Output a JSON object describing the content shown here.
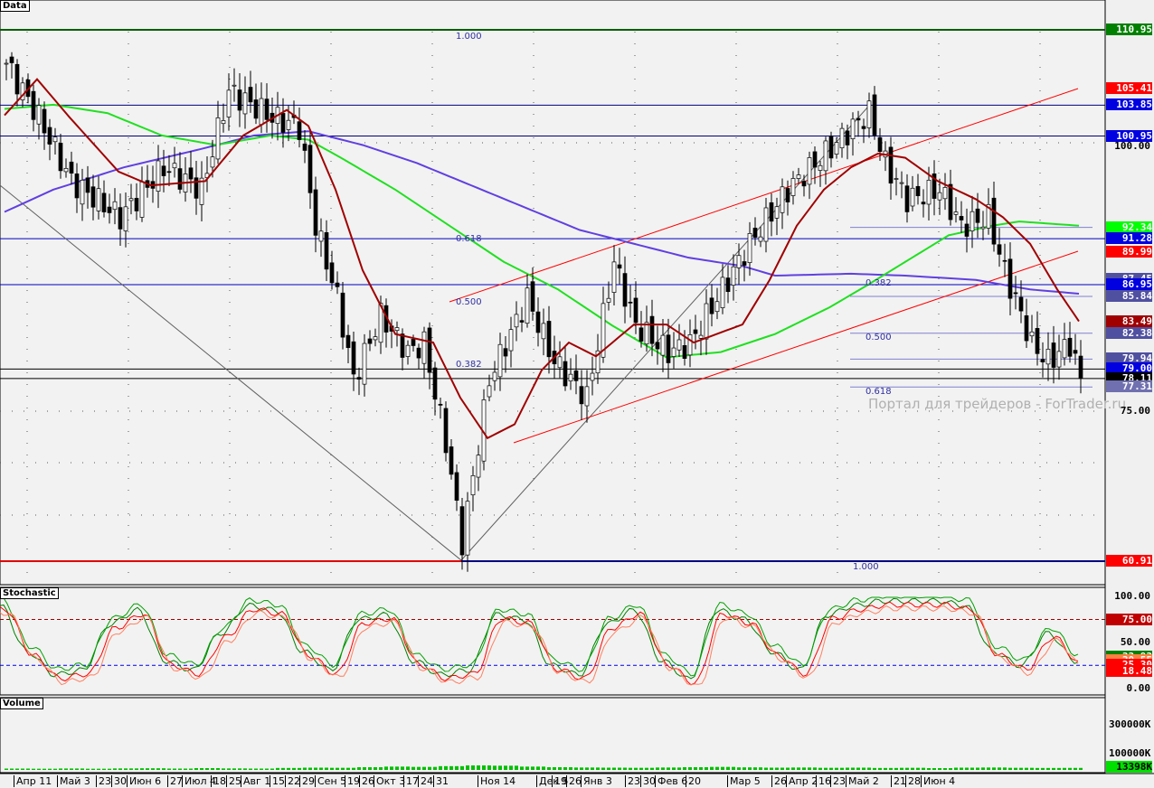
{
  "panes": {
    "main": "Data",
    "stoch": "Stochastic",
    "volume": "Volume"
  },
  "watermark": "Портал для трейдеров - ForTrader.ru",
  "price_tags": [
    {
      "v": "110.95",
      "c": "#008000"
    },
    {
      "v": "105.41",
      "c": "#ff0000"
    },
    {
      "v": "103.85",
      "c": "#0000e0"
    },
    {
      "v": "100.95",
      "c": "#0000e0"
    },
    {
      "v": "92.34",
      "c": "#00ff00"
    },
    {
      "v": "91.28",
      "c": "#0000e0"
    },
    {
      "v": "89.99",
      "c": "#ff0000"
    },
    {
      "v": "87.45",
      "c": "#5050a0"
    },
    {
      "v": "86.95",
      "c": "#0000e0"
    },
    {
      "v": "85.84",
      "c": "#5050a0"
    },
    {
      "v": "83.49",
      "c": "#a00000"
    },
    {
      "v": "82.38",
      "c": "#5050a0"
    },
    {
      "v": "79.94",
      "c": "#5050a0"
    },
    {
      "v": "79.00",
      "c": "#0000e0"
    },
    {
      "v": "78.11",
      "c": "#000000"
    },
    {
      "v": "77.31",
      "c": "#7070b0"
    },
    {
      "v": "60.91",
      "c": "#ff0000"
    }
  ],
  "price_axis": [
    "100.00",
    "75.00"
  ],
  "stoch_axis": [
    "100.00",
    "50.00",
    "0.00"
  ],
  "stoch_tags": [
    {
      "v": "75.00",
      "c": "#c00000"
    },
    {
      "v": "33.93",
      "c": "#008000"
    },
    {
      "v": "30.55",
      "c": "#ff8040"
    },
    {
      "v": "25.30",
      "c": "#ff0000"
    },
    {
      "v": "18.48",
      "c": "#ff0000"
    }
  ],
  "volume_axis": [
    "300000K",
    "100000K"
  ],
  "volume_tag": "13398K",
  "fib_left": [
    "1.000",
    "0.618",
    "0.500",
    "0.382"
  ],
  "fib_right": [
    "0.382",
    "0.500",
    "0.618",
    "1.000"
  ],
  "dates": [
    "Апр 11",
    "Май 3",
    "23",
    "30",
    "Июн 6",
    "27",
    "Июл 4",
    "18",
    "25",
    "Авг 1",
    "15",
    "22",
    "29",
    "Сен 5",
    "19",
    "26",
    "Окт 3",
    "17",
    "24",
    "31",
    "Ноя 14",
    "Дек 5",
    "19",
    "26",
    "Янв 3",
    "23",
    "30",
    "Фев 6",
    "20",
    "Мар 5",
    "26",
    "Апр 2",
    "16",
    "23",
    "Май 2",
    "21",
    "28",
    "Июн 4"
  ],
  "chart_data": {
    "type": "candlestick",
    "ylim": [
      60.91,
      110.95
    ],
    "closes": {
      "t": [
        0,
        6,
        12,
        21,
        29,
        36,
        41,
        49,
        54,
        57,
        61,
        64,
        69,
        74,
        77,
        81,
        84,
        89,
        96,
        101,
        107,
        112,
        116,
        122,
        126,
        131,
        137,
        144,
        151,
        156,
        159,
        162,
        166,
        172,
        176,
        181,
        184,
        189,
        192,
        196,
        198
      ],
      "p": [
        107.8,
        102.7,
        96.7,
        93.3,
        98,
        95.9,
        105.2,
        102.7,
        101.8,
        92.5,
        85.7,
        78,
        84,
        80.6,
        81.4,
        72.1,
        62.7,
        78,
        85.7,
        79.7,
        76.3,
        89.1,
        83.1,
        80.6,
        81.4,
        85.7,
        90.8,
        95.9,
        99.3,
        101.8,
        103.1,
        98.4,
        95,
        95.9,
        92.5,
        93.3,
        88.2,
        81.4,
        79.7,
        81.4,
        78
      ]
    },
    "ma_fast": {
      "t": [
        0,
        6,
        12,
        21,
        27,
        37,
        44,
        52,
        56,
        61,
        66,
        72,
        79,
        84,
        89,
        94,
        99,
        104,
        109,
        116,
        122,
        127,
        136,
        141,
        146,
        151,
        156,
        161,
        166,
        172,
        179,
        184,
        189,
        194,
        198
      ],
      "p": [
        102.9,
        106.3,
        102.7,
        97.6,
        96.3,
        96.7,
        101,
        103.4,
        101.9,
        95.9,
        88.3,
        82.3,
        81.5,
        76.3,
        72.5,
        73.8,
        78.9,
        81.5,
        80.2,
        83.2,
        83.2,
        81.5,
        83.2,
        87.4,
        92.5,
        95.9,
        98,
        99.3,
        98.9,
        96.7,
        95,
        93.3,
        90.8,
        86.5,
        83.5
      ]
    },
    "ma_mid": {
      "t": [
        0,
        9,
        19,
        29,
        39,
        49,
        56,
        62,
        72,
        82,
        92,
        102,
        112,
        122,
        132,
        142,
        152,
        159,
        166,
        174,
        182,
        187,
        198
      ],
      "p": [
        103.5,
        103.9,
        103.1,
        101,
        100.1,
        101,
        100.6,
        98.9,
        95.9,
        92.5,
        89.1,
        86.5,
        83.1,
        80.1,
        80.6,
        82.3,
        84.8,
        86.9,
        89.1,
        91.6,
        92.5,
        92.9,
        92.5
      ]
    },
    "ma_slow": {
      "t": [
        0,
        9,
        22,
        36,
        46,
        56,
        66,
        76,
        86,
        96,
        106,
        116,
        126,
        136,
        142,
        156,
        166,
        179,
        189,
        198
      ],
      "p": [
        93.8,
        95.9,
        98,
        99.7,
        101,
        101.4,
        100.1,
        98.4,
        96.3,
        94.2,
        92.1,
        90.8,
        89.5,
        88.7,
        87.8,
        87.98,
        87.8,
        87.4,
        86.5,
        86.1
      ]
    },
    "stochastic_k": [
      90,
      40,
      15,
      20,
      70,
      85,
      30,
      20,
      60,
      90,
      85,
      40,
      20,
      75,
      80,
      30,
      15,
      20,
      80,
      75,
      25,
      15,
      70,
      85,
      30,
      10,
      85,
      75,
      40,
      20,
      80,
      90,
      95,
      95,
      95,
      90,
      40,
      25,
      60,
      30
    ],
    "stoch_levels": [
      75,
      25.3
    ],
    "volume_k": [
      9000,
      8000,
      9500,
      8000,
      10000,
      11000,
      9000,
      12000,
      10000,
      9000,
      13000,
      15000,
      14000,
      18000,
      22000,
      20000,
      25000,
      30000,
      28000,
      22000,
      18000,
      16000,
      15000,
      14000,
      16000,
      18000,
      20000,
      17000,
      15000,
      16000,
      14000,
      15000,
      13000,
      14000,
      12000,
      15000,
      16000,
      14000,
      13000,
      13398
    ]
  }
}
